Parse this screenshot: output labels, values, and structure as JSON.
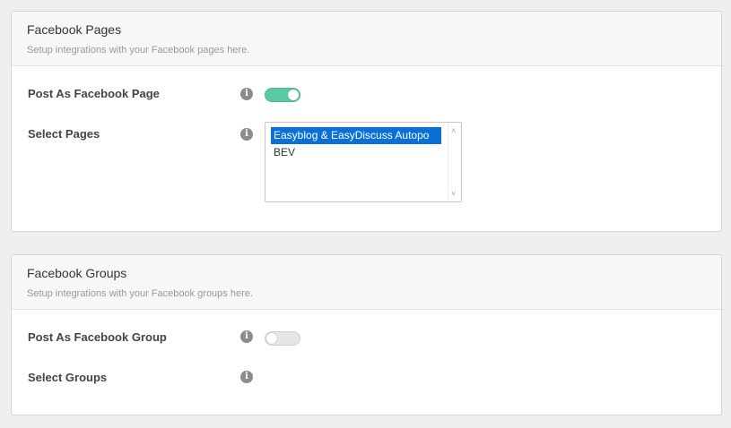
{
  "pages_panel": {
    "title": "Facebook Pages",
    "description": "Setup integrations with your Facebook pages here.",
    "post_as_label": "Post As Facebook Page",
    "post_as_enabled": true,
    "select_label": "Select Pages",
    "options": [
      "Easyblog & EasyDiscuss Autopo",
      "BEV"
    ],
    "selected_option": "Easyblog & EasyDiscuss Autopo"
  },
  "groups_panel": {
    "title": "Facebook Groups",
    "description": "Setup integrations with your Facebook groups here.",
    "post_as_label": "Post As Facebook Group",
    "post_as_enabled": false,
    "select_label": "Select Groups"
  },
  "icons": {
    "info": "i",
    "scroll_up": "˄",
    "scroll_down": "˅"
  },
  "colors": {
    "toggle_on": "#5bc9a0",
    "selection": "#0a6fd6"
  }
}
